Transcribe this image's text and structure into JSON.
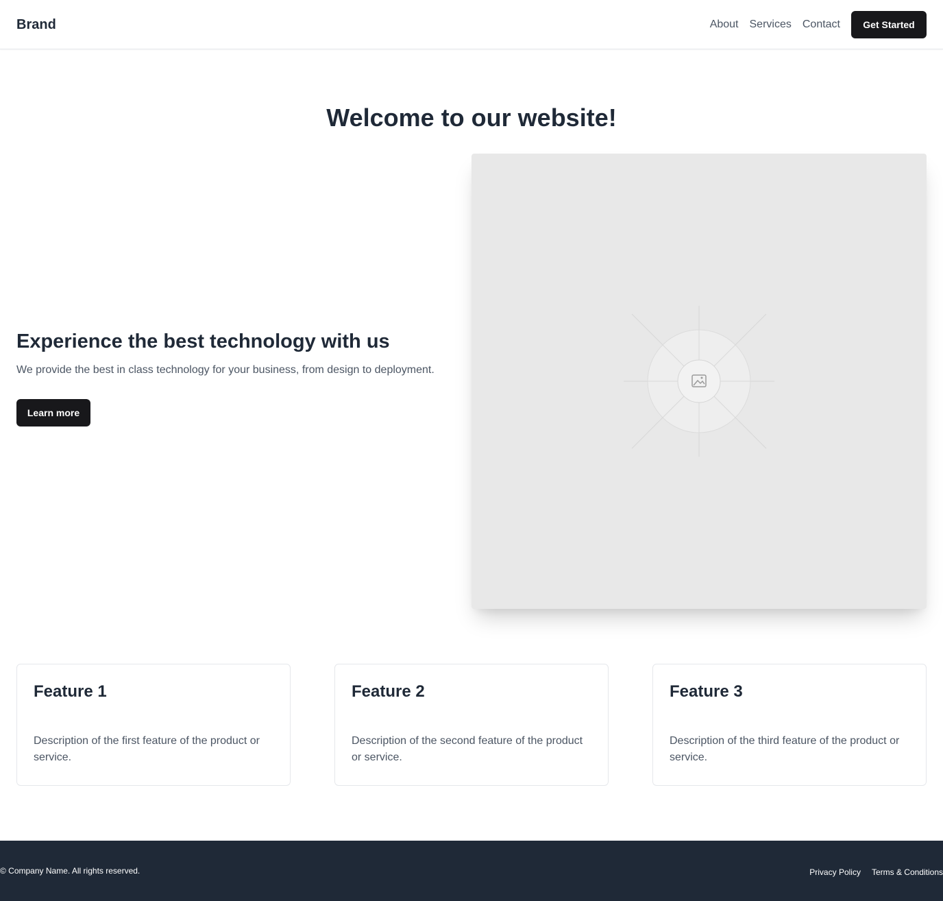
{
  "header": {
    "brand": "Brand",
    "nav": {
      "about": "About",
      "services": "Services",
      "contact": "Contact"
    },
    "cta_label": "Get Started"
  },
  "hero": {
    "title": "Welcome to our website!",
    "heading": "Experience the best technology with us",
    "description": "We provide the best in class technology for your business, from design to deployment.",
    "button_label": "Learn more",
    "image_icon": "image-placeholder-icon"
  },
  "features": [
    {
      "title": "Feature 1",
      "description": "Description of the first feature of the product or service."
    },
    {
      "title": "Feature 2",
      "description": "Description of the second feature of the product or service."
    },
    {
      "title": "Feature 3",
      "description": "Description of the third feature of the product or service."
    }
  ],
  "footer": {
    "copyright": "© Company Name. All rights reserved.",
    "links": {
      "privacy": "Privacy Policy",
      "terms": "Terms & Conditions"
    }
  },
  "colors": {
    "text_dark": "#1f2937",
    "text_muted": "#4b5563",
    "button_dark": "#18181b",
    "footer_bg": "#1f2937",
    "image_bg": "#e8e8e8"
  }
}
